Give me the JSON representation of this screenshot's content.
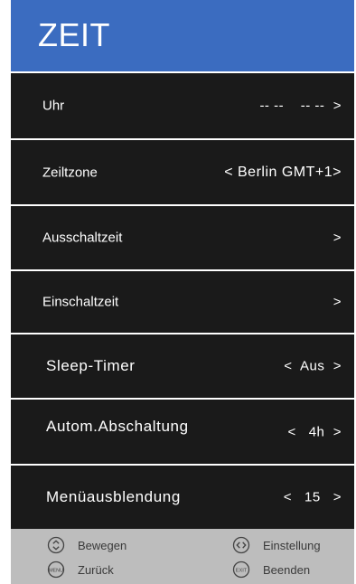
{
  "header": {
    "title": "ZEIT"
  },
  "rows": [
    {
      "label": "Uhr",
      "value": "-- --    -- --  >"
    },
    {
      "label": "Zeiltzone",
      "value": "< Berlin GMT+1>"
    },
    {
      "label": "Ausschaltzeit",
      "value": ">"
    },
    {
      "label": "Einschaltzeit",
      "value": ">"
    },
    {
      "label": "Sleep-Timer",
      "value": "<  Aus  >"
    },
    {
      "label": "Autom.Abschaltung",
      "value": "<   4h  >"
    },
    {
      "label": "Menüausblendung",
      "value": "<   15   >"
    }
  ],
  "footer": {
    "move": {
      "icon": "up-down-icon",
      "label": "Bewegen"
    },
    "adjust": {
      "icon": "left-right-icon",
      "label": "Einstellung"
    },
    "back": {
      "icon": "menu-button-icon",
      "icon_text": "MENU",
      "label": "Zurück"
    },
    "exit": {
      "icon": "exit-button-icon",
      "icon_text": "EXIT",
      "label": "Beenden"
    }
  },
  "colors": {
    "header": "#3b6cc0",
    "row_bg": "#1a1a1a",
    "footer_bg": "#bdbdbd",
    "text": "#ffffff"
  }
}
